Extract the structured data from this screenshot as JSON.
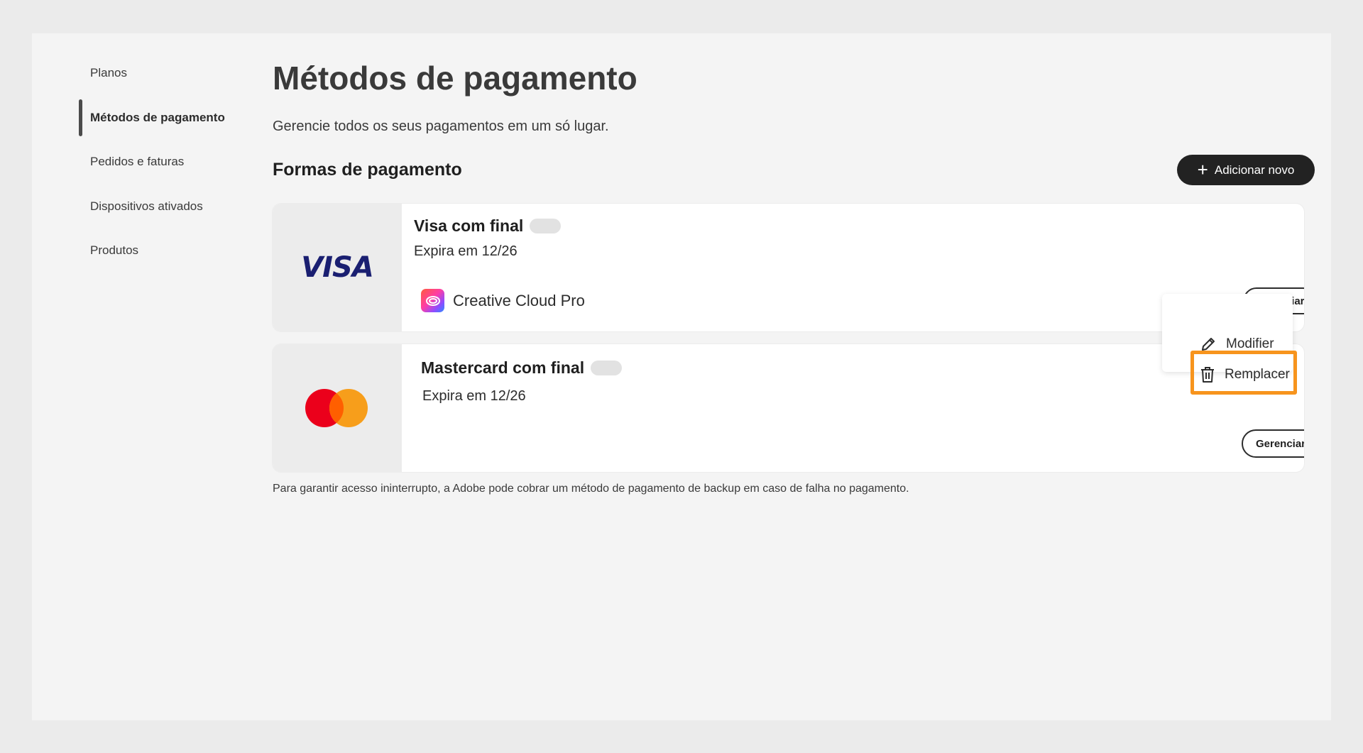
{
  "sidebar": {
    "items": [
      {
        "label": "Planos"
      },
      {
        "label": "Métodos de pagamento",
        "active": true
      },
      {
        "label": "Pedidos e faturas"
      },
      {
        "label": "Dispositivos ativados"
      },
      {
        "label": "Produtos"
      }
    ]
  },
  "header": {
    "title": "Métodos de pagamento",
    "subtitle": "Gerencie todos os seus pagamentos em um só lugar."
  },
  "section": {
    "title": "Formas de pagamento",
    "add_button": "Adicionar novo"
  },
  "cards": [
    {
      "brand": "VISA",
      "name": "Visa com final",
      "expiry": "Expira em 12/26",
      "product": "Creative Cloud Pro",
      "manage_label": "Gerenciar"
    },
    {
      "brand": "mastercard",
      "name": "Mastercard com final",
      "expiry": "Expira em 12/26",
      "manage_label": "Gerenciar"
    }
  ],
  "menu": {
    "items": [
      {
        "label": "Modifier",
        "icon": "pencil-icon"
      },
      {
        "label": "Remplacer",
        "icon": "trash-icon"
      }
    ],
    "highlight_color": "#f7941d"
  },
  "footnote": "Para garantir acesso ininterrupto, a Adobe pode cobrar um método de pagamento de backup em caso de falha no pagamento.",
  "colors": {
    "visa_blue": "#1a1f71",
    "mastercard_red": "#eb001b",
    "mastercard_orange": "#f79e1b",
    "button_dark": "#222222"
  }
}
